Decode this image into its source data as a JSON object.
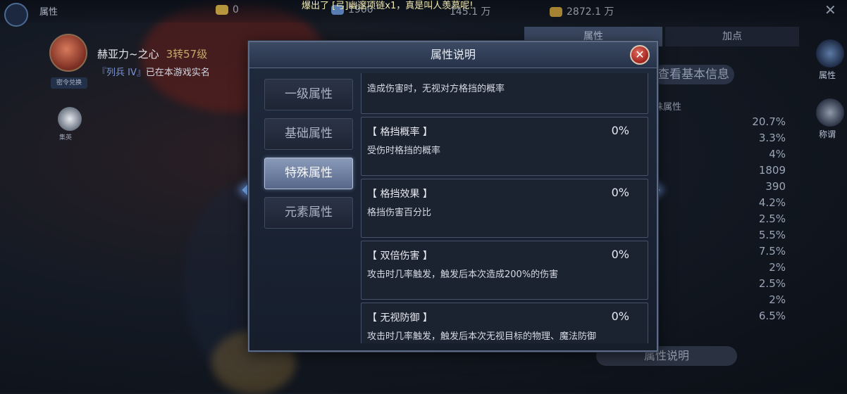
{
  "topbar": {
    "title": "属性",
    "currencies": [
      {
        "icon": "gem-icon",
        "value": "0",
        "color": "#e8c24a"
      },
      {
        "icon": "crystal-icon",
        "value": "1900",
        "color": "#6fa0e6"
      },
      {
        "icon": "diamond-icon",
        "value": "145.1 万",
        "color": "#8fb4e8"
      },
      {
        "icon": "gold-icon",
        "value": "2872.1 万",
        "color": "#d9a93a"
      }
    ],
    "broadcast": "爆出了 [弓]幽邃项链x1，真是叫人羡慕呢!"
  },
  "player": {
    "name": "赫亚力~之心",
    "level": "3转57级",
    "title_tag": "『列兵 IV』",
    "title_text": "已在本游戏实名",
    "badge": "密令兑换",
    "reward_label": "集英"
  },
  "right_panel": {
    "tabs": [
      "属性",
      "加点"
    ],
    "view_basic": "查看基本信息",
    "section_header": "殊属性",
    "values": [
      "20.7%",
      "3.3%",
      "4%",
      "1809",
      "390",
      "4.2%",
      "2.5%",
      "5.5%",
      "7.5%",
      "2%",
      "2.5%",
      "2%",
      "6.5%"
    ],
    "side_nav": [
      {
        "icon": "attribute-icon",
        "label": "属性"
      },
      {
        "icon": "title-crest-icon",
        "label": "称谓"
      }
    ],
    "explain_button": "属性说明"
  },
  "dialog": {
    "title": "属性说明",
    "tabs": [
      {
        "label": "一级属性",
        "active": false
      },
      {
        "label": "基础属性",
        "active": false
      },
      {
        "label": "特殊属性",
        "active": true
      },
      {
        "label": "元素属性",
        "active": false
      }
    ],
    "partial_card": {
      "desc": "造成伤害时，无视对方格挡的概率"
    },
    "attributes": [
      {
        "name": "【 格挡概率 】",
        "value": "0%",
        "desc": "受伤时格挡的概率"
      },
      {
        "name": "【 格挡效果 】",
        "value": "0%",
        "desc": "格挡伤害百分比"
      },
      {
        "name": "【 双倍伤害 】",
        "value": "0%",
        "desc": "攻击时几率触发，触发后本次造成200%的伤害"
      },
      {
        "name": "【 无视防御 】",
        "value": "0%",
        "desc": "攻击时几率触发，触发后本次无视目标的物理、魔法防御"
      }
    ]
  }
}
